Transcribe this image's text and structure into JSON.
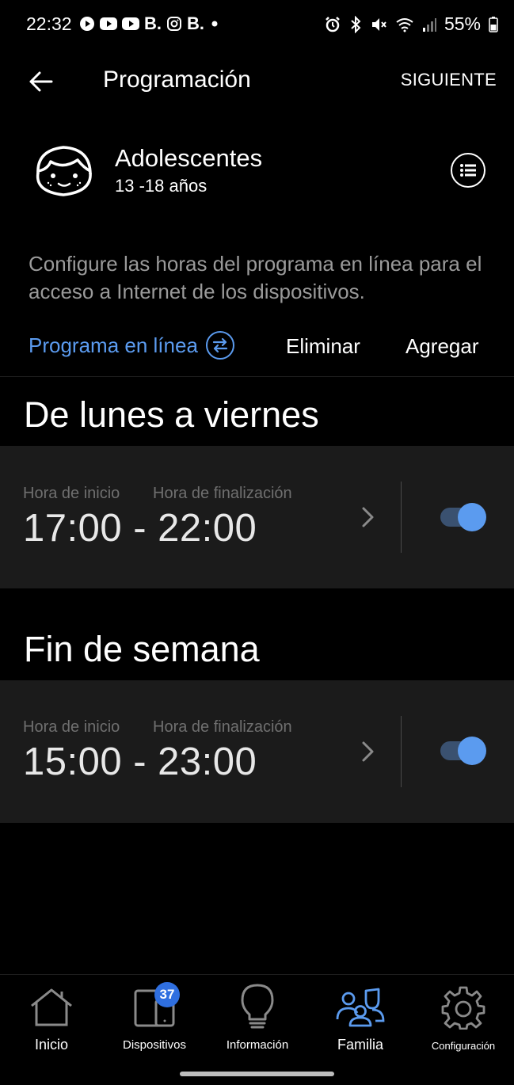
{
  "status_bar": {
    "time": "22:32",
    "battery": "55%",
    "left_icons": [
      "play-icon",
      "youtube-icon",
      "youtube-icon",
      "b-icon",
      "instagram-icon",
      "b-icon",
      "dot-icon"
    ],
    "right_icons": [
      "alarm-icon",
      "bluetooth-icon",
      "mute-icon",
      "wifi-icon",
      "signal-icon",
      "battery-icon"
    ]
  },
  "header": {
    "title": "Programación",
    "next_label": "SIGUIENTE"
  },
  "profile": {
    "name": "Adolescentes",
    "age_range": "13 -18 años"
  },
  "description": "Configure las horas del programa en línea para el acceso a Internet de los dispositivos.",
  "actions": {
    "program_label": "Programa en línea",
    "delete_label": "Eliminar",
    "add_label": "Agregar"
  },
  "schedules": [
    {
      "title": "De lunes a viernes",
      "start_label": "Hora de inicio",
      "end_label": "Hora de finalización",
      "times": "17:00 - 22:00",
      "enabled": true
    },
    {
      "title": "Fin de semana",
      "start_label": "Hora de inicio",
      "end_label": "Hora de finalización",
      "times": "15:00 - 23:00",
      "enabled": true
    }
  ],
  "bottom_nav": {
    "items": [
      {
        "label": "Inicio",
        "icon": "home-icon"
      },
      {
        "label": "Dispositivos",
        "icon": "devices-icon",
        "badge": "37"
      },
      {
        "label": "Información",
        "icon": "lightbulb-icon"
      },
      {
        "label": "Familia",
        "icon": "family-icon",
        "active": true
      },
      {
        "label": "Configuración",
        "icon": "gear-icon"
      }
    ]
  },
  "colors": {
    "accent": "#5b9bef",
    "background": "#000000",
    "card": "#1b1b1b",
    "muted_text": "#9a9a9a",
    "badge": "#2f6fe0"
  }
}
